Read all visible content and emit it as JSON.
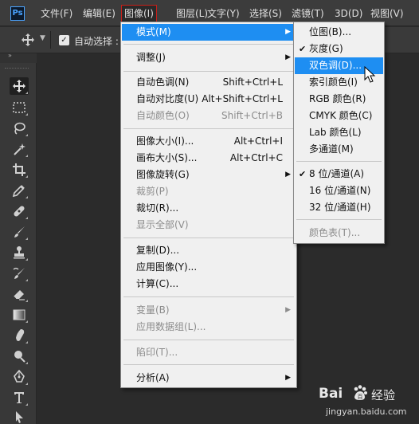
{
  "menubar": {
    "logo": "Ps",
    "items": [
      "文件(F)",
      "编辑(E)",
      "图像(I)",
      "图层(L)",
      "文字(Y)",
      "选择(S)",
      "滤镜(T)",
      "3D(D)",
      "视图(V)"
    ]
  },
  "optionsbar": {
    "auto_select_label": "自动选择 :",
    "auto_select_checked": true
  },
  "tools": [
    "move-tool",
    "marquee-tool",
    "lasso-tool",
    "magic-wand-tool",
    "crop-tool",
    "eyedropper-tool",
    "healing-brush-tool",
    "brush-tool",
    "clone-stamp-tool",
    "history-brush-tool",
    "eraser-tool",
    "gradient-tool",
    "blur-tool",
    "dodge-tool",
    "pen-tool",
    "type-tool",
    "path-selection-tool"
  ],
  "image_menu": {
    "mode": "模式(M)",
    "adjust": "调整(J)",
    "auto_tone": {
      "label": "自动色调(N)",
      "shortcut": "Shift+Ctrl+L"
    },
    "auto_contrast": {
      "label": "自动对比度(U)",
      "shortcut": "Alt+Shift+Ctrl+L"
    },
    "auto_color": {
      "label": "自动颜色(O)",
      "shortcut": "Shift+Ctrl+B"
    },
    "image_size": {
      "label": "图像大小(I)...",
      "shortcut": "Alt+Ctrl+I"
    },
    "canvas_size": {
      "label": "画布大小(S)...",
      "shortcut": "Alt+Ctrl+C"
    },
    "image_rotation": "图像旋转(G)",
    "crop": "裁剪(P)",
    "trim": "裁切(R)...",
    "reveal_all": "显示全部(V)",
    "duplicate": "复制(D)...",
    "apply_image": "应用图像(Y)...",
    "calculations": "计算(C)...",
    "variables": "变量(B)",
    "apply_data_set": "应用数据组(L)...",
    "trap": "陷印(T)...",
    "analysis": "分析(A)"
  },
  "mode_submenu": {
    "bitmap": "位图(B)...",
    "grayscale": "灰度(G)",
    "duotone": "双色调(D)...",
    "indexed": "索引颜色(I)",
    "rgb": "RGB 颜色(R)",
    "cmyk": "CMYK 颜色(C)",
    "lab": "Lab 颜色(L)",
    "multichannel": "多通道(M)",
    "bits8": "8 位/通道(A)",
    "bits16": "16 位/通道(N)",
    "bits32": "32 位/通道(H)",
    "color_table": "颜色表(T)...",
    "check_glyph": "✔"
  },
  "watermark": {
    "logo": "Bai",
    "logo_end": "百",
    "cn": "经验",
    "url": "jingyan.baidu.com"
  }
}
